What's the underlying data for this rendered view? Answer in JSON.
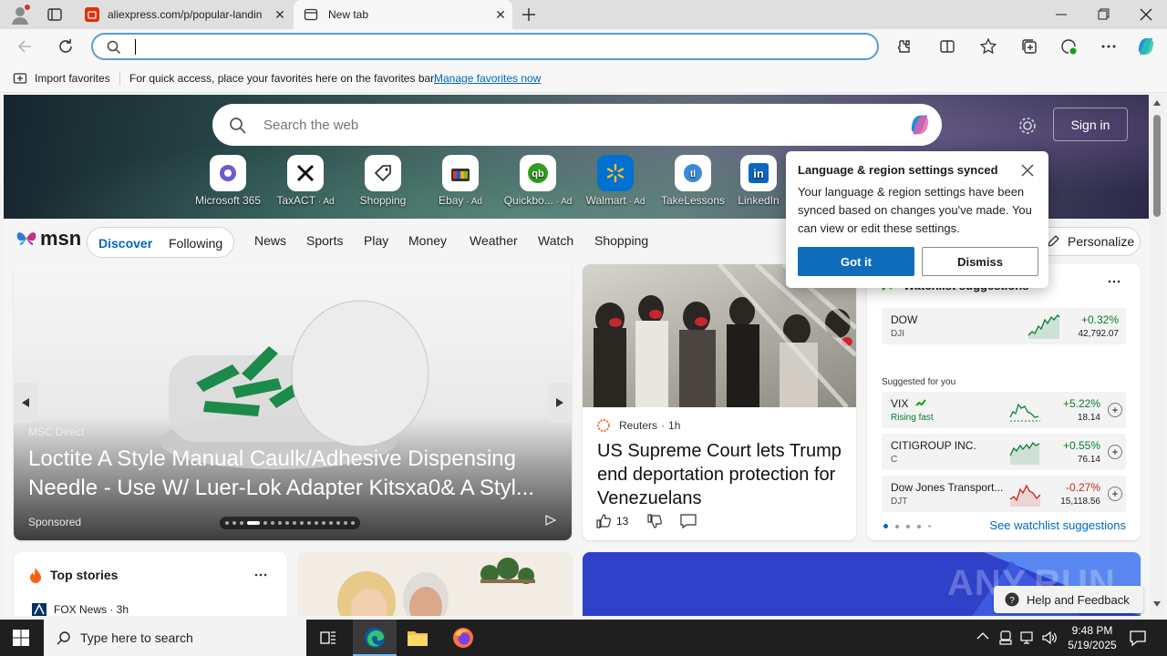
{
  "browser": {
    "tabs": [
      {
        "title": "aliexpress.com/p/popular-landin",
        "active": false
      },
      {
        "title": "New tab",
        "active": true
      }
    ],
    "address": {
      "value": ""
    },
    "favorites_bar": {
      "import_label": "Import favorites",
      "hint": "For quick access, place your favorites here on the favorites bar.",
      "manage_link": "Manage favorites now"
    }
  },
  "newtab": {
    "search_placeholder": "Search the web",
    "sign_in": "Sign in",
    "quick_links": [
      {
        "label": "Microsoft 365",
        "ad": false,
        "icon": "microsoft365-icon"
      },
      {
        "label": "TaxACT",
        "ad": true,
        "icon": "taxact-icon"
      },
      {
        "label": "Shopping",
        "ad": false,
        "icon": "tag-icon"
      },
      {
        "label": "Ebay",
        "ad": true,
        "icon": "ebay-icon"
      },
      {
        "label": "Quickbo...",
        "ad": true,
        "icon": "quickbooks-icon"
      },
      {
        "label": "Walmart",
        "ad": true,
        "icon": "walmart-icon"
      },
      {
        "label": "TakeLessons",
        "ad": false,
        "icon": "takelessons-icon"
      },
      {
        "label": "LinkedIn",
        "ad": false,
        "icon": "linkedin-icon"
      }
    ],
    "ad_tag": "Ad"
  },
  "msn": {
    "logo": "msn",
    "tabs": [
      "Discover",
      "Following"
    ],
    "nav": [
      "News",
      "Sports",
      "Play",
      "Money",
      "Weather",
      "Watch",
      "Shopping"
    ],
    "personalize": "Personalize"
  },
  "hero_card": {
    "source": "MSC Direct",
    "title": "Loctite A Style Manual Caulk/Adhesive Dispensing Needle - Use W/ Luer-Lok Adapter Kitsxa0& A Styl...",
    "sponsored": "Sponsored",
    "slide_count": 17,
    "active_slide": 3
  },
  "news_card": {
    "source": "Reuters",
    "age": "1h",
    "headline": "US Supreme Court lets Trump end deportation protection for Venezuelans",
    "likes": "13"
  },
  "watchlist": {
    "title": "Watchlist suggestions",
    "main": {
      "name": "DOW",
      "symbol": "DJI",
      "change": "+0.32%",
      "price": "42,792.07",
      "color": "#0a7c2f"
    },
    "suggested_label": "Suggested for you",
    "suggestions": [
      {
        "name": "VIX",
        "symbol": "",
        "tag": "Rising fast",
        "change": "+5.22%",
        "price": "18.14",
        "color": "#0a7c2f"
      },
      {
        "name": "CITIGROUP INC.",
        "symbol": "C",
        "tag": "",
        "change": "+0.55%",
        "price": "76.14",
        "color": "#0a7c2f"
      },
      {
        "name": "Dow Jones Transport...",
        "symbol": "DJT",
        "tag": "",
        "change": "-0.27%",
        "price": "15,118.56",
        "color": "#c42b1c"
      }
    ],
    "see_more": "See watchlist suggestions"
  },
  "top_stories": {
    "title": "Top stories",
    "first_source": "FOX News · 3h"
  },
  "popup": {
    "title": "Language & region settings synced",
    "body": "Your language & region settings have been synced based on changes you've made. You can view or edit these settings.",
    "primary": "Got it",
    "secondary": "Dismiss"
  },
  "help_feedback": "Help and Feedback",
  "watermark": "ANY.RUN",
  "taskbar": {
    "search_placeholder": "Type here to search",
    "time": "9:48 PM",
    "date": "5/19/2025"
  },
  "colors": {
    "accent": "#0067c0",
    "button_primary": "#0f6cbd",
    "positive": "#0a7c2f",
    "negative": "#c42b1c"
  }
}
